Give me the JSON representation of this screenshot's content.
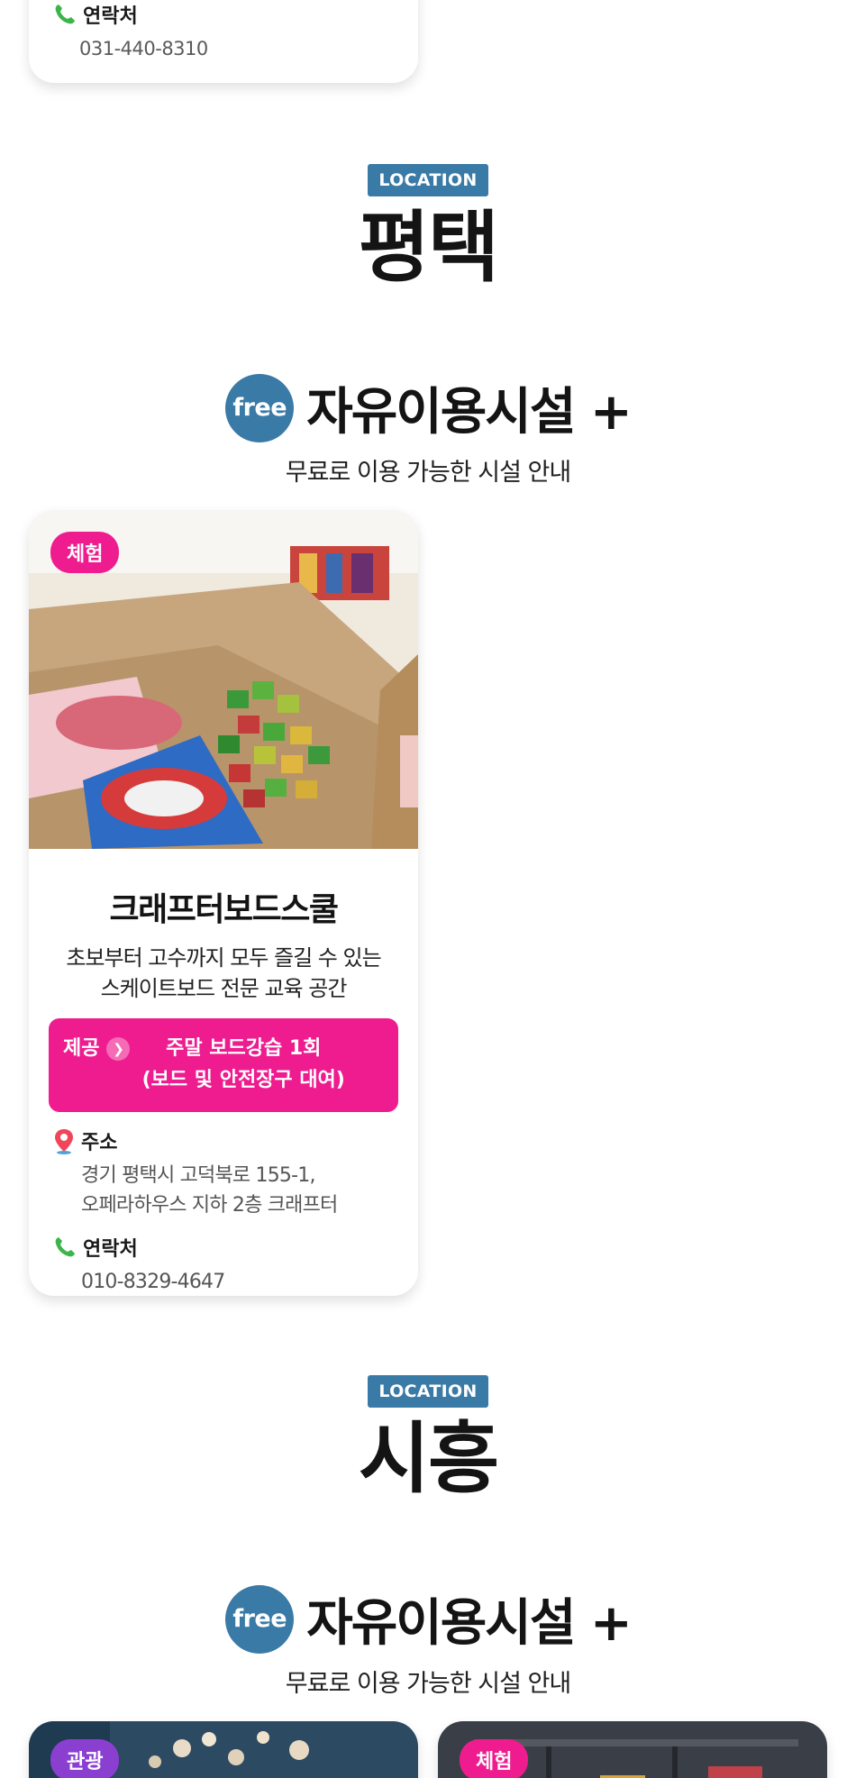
{
  "top_card": {
    "contact_label": "연락처",
    "contact_value": "031-440-8310"
  },
  "pyeongtaek": {
    "badge": "LOCATION",
    "city": "평택",
    "free_badge": "free",
    "free_title": "자유이용시설 +",
    "free_subtitle": "무료로 이용 가능한 시설 안내",
    "card": {
      "tag": "체험",
      "tag_color": "#ee1c8f",
      "name": "크래프터보드스쿨",
      "desc_line1": "초보부터 고수까지 모두 즐길 수 있는",
      "desc_line2": "스케이트보드 전문 교육 공간",
      "offer_label": "제공",
      "offer_line1": "주말 보드강습 1회",
      "offer_line2": "(보드 및 안전장구 대여)",
      "address_label": "주소",
      "address_line1": "경기 평택시 고덕북로 155-1,",
      "address_line2": "오페라하우스 지하 2층 크래프터",
      "contact_label": "연락처",
      "contact_value": "010-8329-4647"
    }
  },
  "siheung": {
    "badge": "LOCATION",
    "city": "시흥",
    "free_badge": "free",
    "free_title": "자유이용시설 +",
    "free_subtitle": "무료로 이용 가능한 시설 안내",
    "cards": [
      {
        "tag": "관광",
        "tag_color": "#8b3fd1"
      },
      {
        "tag": "체험",
        "tag_color": "#ee1c8f"
      }
    ]
  },
  "colors": {
    "accent_blue": "#3a7aa6",
    "accent_pink": "#ee1c8f",
    "accent_purple": "#8b3fd1"
  },
  "icons": {
    "phone": "phone-icon",
    "pin": "location-pin-icon",
    "chevron": "chevron-right-icon"
  }
}
